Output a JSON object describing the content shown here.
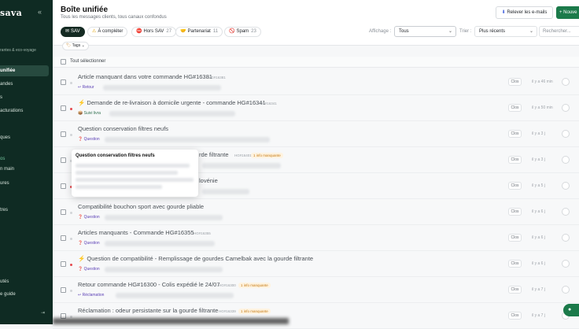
{
  "sidebar": {
    "brand": "sava",
    "collapse_icon": "«",
    "subtitle": "rantes & eco-voyage",
    "items": [
      {
        "label": "unifiée",
        "active": true
      },
      {
        "label": "andes"
      },
      {
        "label": "s"
      },
      {
        "label": "acturations"
      },
      {
        "label": "ques"
      },
      {
        "label": "os"
      },
      {
        "label": "n main"
      },
      {
        "label": "ures"
      },
      {
        "label": "tres"
      },
      {
        "label": "utés"
      },
      {
        "label": "e guide"
      }
    ]
  },
  "header": {
    "title": "Boîte unifiée",
    "subtitle": "Tous les messages clients, tous canaux confondus",
    "fetch_button": "Relever les e-mails",
    "new_button": "+ Nouve"
  },
  "filters": {
    "chips": [
      {
        "icon": "✉",
        "label": "SAV",
        "count": "",
        "active": true
      },
      {
        "icon": "⚠",
        "label": "À compléter",
        "count": ""
      },
      {
        "icon": "⛔",
        "label": "Hors SAV",
        "count": "27"
      },
      {
        "icon": "🤝",
        "label": "Partenariat",
        "count": "11"
      },
      {
        "icon": "🚫",
        "label": "Spam",
        "count": "23"
      }
    ],
    "display_label": "Affichage :",
    "display_value": "Tous",
    "sort_label": "Trier :",
    "sort_value": "Plus récents",
    "search_placeholder": "Rechercher...",
    "tags_label": "Tags"
  },
  "select_all_label": "Tout sélectionner",
  "rows": [
    {
      "subject": "Article manquant dans votre commande HG#16381",
      "ref": "HG#16381",
      "tag": "Retour",
      "tag_icon": "↩",
      "status": "Clos",
      "time": "il y a 46 min",
      "dot": "grey"
    },
    {
      "subject": "⚡ Demande de re-livraison à domicile urgente - commande HG#16341",
      "ref": "HG#16341",
      "tag": "Suivi livra",
      "tag_icon": "📦",
      "status": "Clos",
      "time": "il y a 50 min",
      "dot": "red"
    },
    {
      "subject": "Question conservation filtres neufs",
      "ref": "",
      "tag": "Question",
      "tag_icon": "❓",
      "status": "Clos",
      "time": "il y a 3 j",
      "dot": "grey"
    },
    {
      "subject": "rde filtrante",
      "ref": "HG#16401",
      "badge": "1 info manquante",
      "tag": "",
      "status": "Clos",
      "time": "il y a 3 j",
      "dot": "grey"
    },
    {
      "subject": "lovénie",
      "ref": "",
      "tag": "",
      "status": "Clos",
      "time": "il y a 5 j",
      "dot": "red"
    },
    {
      "subject": "Compatibilité bouchon sport avec gourde pliable",
      "ref": "",
      "tag": "Question",
      "tag_icon": "❓",
      "status": "Clos",
      "time": "il y a 6 j",
      "dot": "grey"
    },
    {
      "subject": "Articles manquants - Commande HG#16355",
      "ref": "HG#16355",
      "tag": "Question",
      "tag_icon": "❓",
      "status": "Clos",
      "time": "il y a 6 j",
      "dot": "grey"
    },
    {
      "subject": "⚡ Question de compatibilité - Remplissage de gourdes Camelbak avec la gourde filtrante",
      "ref": "",
      "tag": "Question",
      "tag_icon": "❓",
      "status": "Clos",
      "time": "il y a 6 j",
      "dot": "red"
    },
    {
      "subject": "Retour commande HG#16300 - Colis expédié le 24/07",
      "ref": "HG#16300",
      "badge": "1 info manquante",
      "tag": "Réclamation",
      "tag_icon": "↩",
      "status": "Clos",
      "time": "il y a 7 j",
      "dot": "grey"
    },
    {
      "subject": "Réclamation : odeur persistante sur la gourde filtrante",
      "ref": "HG#16339",
      "badge": "1 info manquante",
      "tag": "",
      "status": "Clos",
      "time": "il y a 7 j",
      "dot": "grey"
    }
  ],
  "popover": {
    "title": "Question conservation filtres neufs"
  },
  "fab_icon": "pin-icon",
  "colors": {
    "sidebar": "#0f2b23",
    "accent": "#1b7a4a",
    "unread": "#e5484d"
  }
}
